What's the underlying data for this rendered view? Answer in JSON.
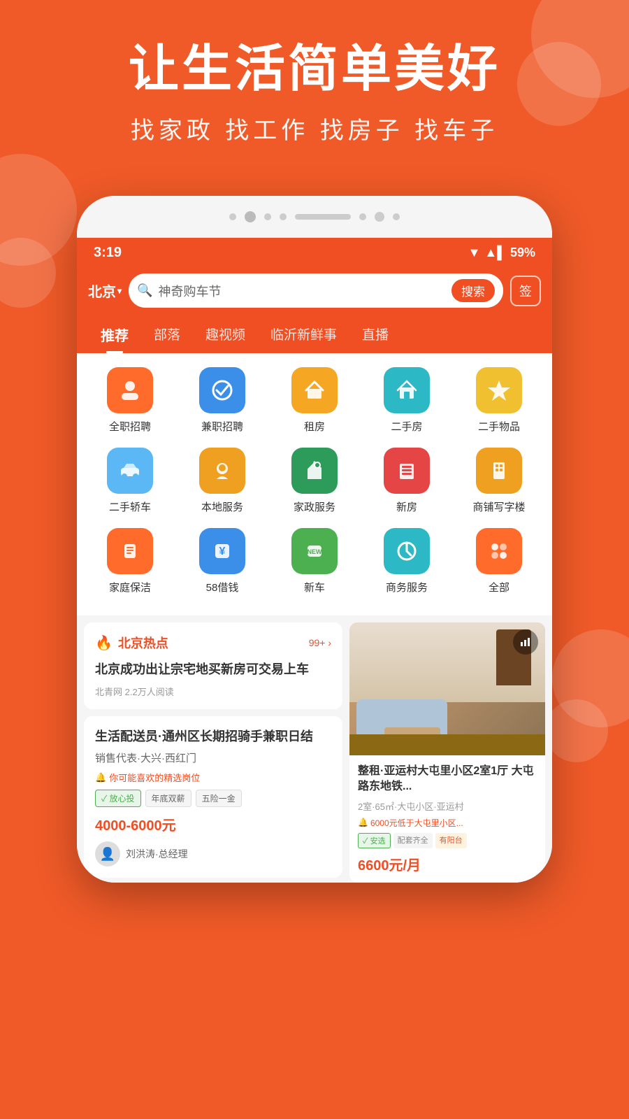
{
  "app": {
    "bg_color": "#f04e23"
  },
  "hero": {
    "title": "让生活简单美好",
    "subtitle": "找家政 找工作 找房子 找车子"
  },
  "status_bar": {
    "time": "3:19",
    "battery": "59%",
    "signal": "▼▲"
  },
  "search": {
    "city": "北京",
    "placeholder": "神奇购车节",
    "button": "搜索",
    "sign": "签"
  },
  "nav_tabs": [
    {
      "label": "推荐",
      "active": true
    },
    {
      "label": "部落",
      "active": false
    },
    {
      "label": "趣视频",
      "active": false
    },
    {
      "label": "临沂新鲜事",
      "active": false
    },
    {
      "label": "直播",
      "active": false
    }
  ],
  "icons": [
    [
      {
        "label": "全职招聘",
        "emoji": "👤",
        "color": "icon-orange"
      },
      {
        "label": "兼职招聘",
        "emoji": "✔",
        "color": "icon-blue"
      },
      {
        "label": "租房",
        "emoji": "🛋",
        "color": "icon-yellow"
      },
      {
        "label": "二手房",
        "emoji": "🏠",
        "color": "icon-teal"
      },
      {
        "label": "二手物品",
        "emoji": "⭐",
        "color": "icon-gold"
      }
    ],
    [
      {
        "label": "二手轿车",
        "emoji": "🚗",
        "color": "icon-skyblue"
      },
      {
        "label": "本地服务",
        "emoji": "😊",
        "color": "icon-amber"
      },
      {
        "label": "家政服务",
        "emoji": "🏡",
        "color": "icon-dkgreen"
      },
      {
        "label": "新房",
        "emoji": "📋",
        "color": "icon-red"
      },
      {
        "label": "商铺写字楼",
        "emoji": "💼",
        "color": "icon-amber"
      }
    ],
    [
      {
        "label": "家庭保洁",
        "emoji": "🧹",
        "color": "icon-orange"
      },
      {
        "label": "58借钱",
        "emoji": "¥",
        "color": "icon-blue"
      },
      {
        "label": "新车",
        "emoji": "NEW",
        "color": "icon-green"
      },
      {
        "label": "商务服务",
        "emoji": "⏰",
        "color": "icon-teal"
      },
      {
        "label": "全部",
        "emoji": "⋮⋮",
        "color": "icon-orange"
      }
    ]
  ],
  "hot_news": {
    "title": "北京热点",
    "badge": "99+",
    "content": "北京成功出让宗宅地买新房可交易上车",
    "source": "北青网",
    "reads": "2.2万人阅读"
  },
  "job_listing": {
    "title": "生活配送员·通州区长期招骑手兼职日结",
    "subtitle": "销售代表·大兴·西红门",
    "recommend": "你可能喜欢的精选岗位",
    "tags": [
      "放心投",
      "年底双薪",
      "五险一金"
    ],
    "salary": "4000-6000元",
    "poster_name": "刘洪涛·总经理"
  },
  "property_listing": {
    "title": "整租·亚运村大屯里小区2室1厅 大屯路东地铁...",
    "meta": "2室·65㎡·大屯小区·亚运村",
    "alert": "6000元低于大屯里小区...",
    "tags": [
      "安选",
      "配套齐全",
      "有阳台"
    ],
    "price": "6600元/月"
  }
}
